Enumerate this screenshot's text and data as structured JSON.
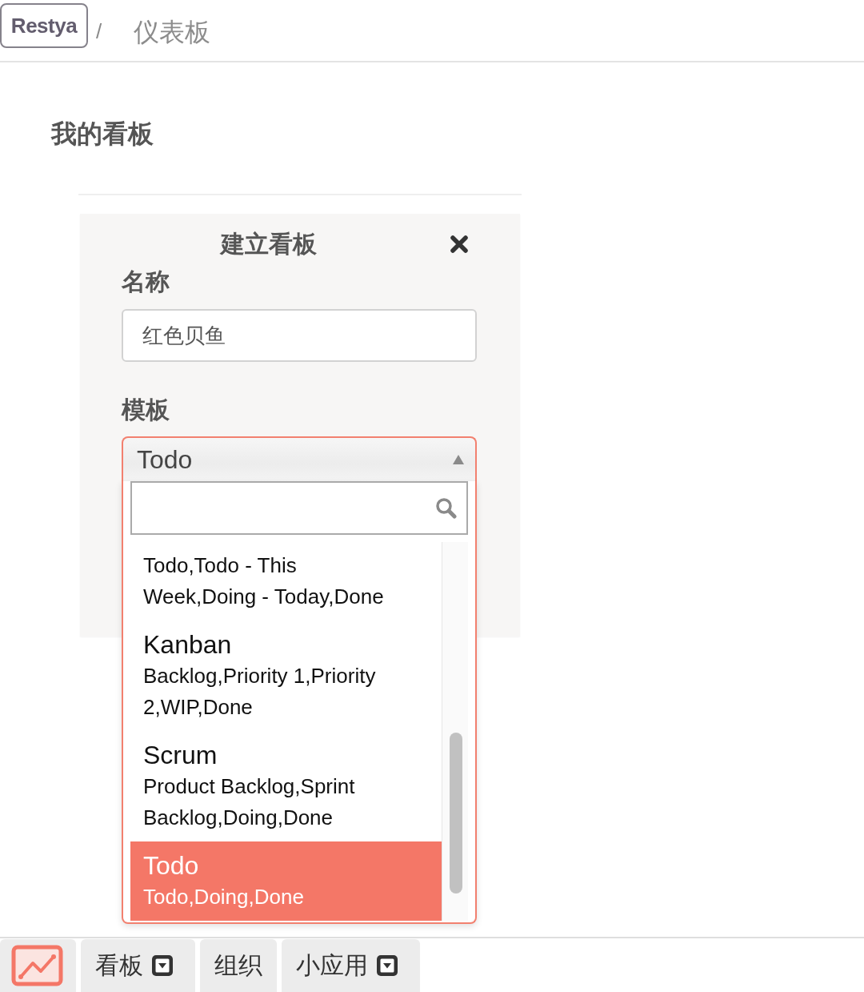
{
  "header": {
    "logo": "Restya",
    "separator": "/",
    "title": "仪表板"
  },
  "section": {
    "title": "我的看板"
  },
  "dialog": {
    "title": "建立看板",
    "fields": [
      {
        "kind": "text",
        "label": "名称",
        "value": "红色贝鱼"
      },
      {
        "kind": "select",
        "label": "模板",
        "value": "Todo",
        "expanded": true,
        "options": [
          {
            "description": "Todo,Todo - This Week,Doing - Today,Done",
            "selected": false
          },
          {
            "title": "Kanban",
            "description": "Backlog,Priority 1,Priority 2,WIP,Done",
            "selected": false
          },
          {
            "title": "Scrum",
            "description": "Product Backlog,Sprint Backlog,Doing,Done",
            "selected": false
          },
          {
            "title": "Todo",
            "description": "Todo,Doing,Done",
            "selected": true
          }
        ]
      }
    ]
  },
  "bottom_bar": {
    "items": [
      {
        "kind": "icon"
      },
      {
        "kind": "menu",
        "label": "看板"
      },
      {
        "kind": "link",
        "label": "组织"
      },
      {
        "kind": "menu",
        "label": "小应用"
      }
    ]
  }
}
